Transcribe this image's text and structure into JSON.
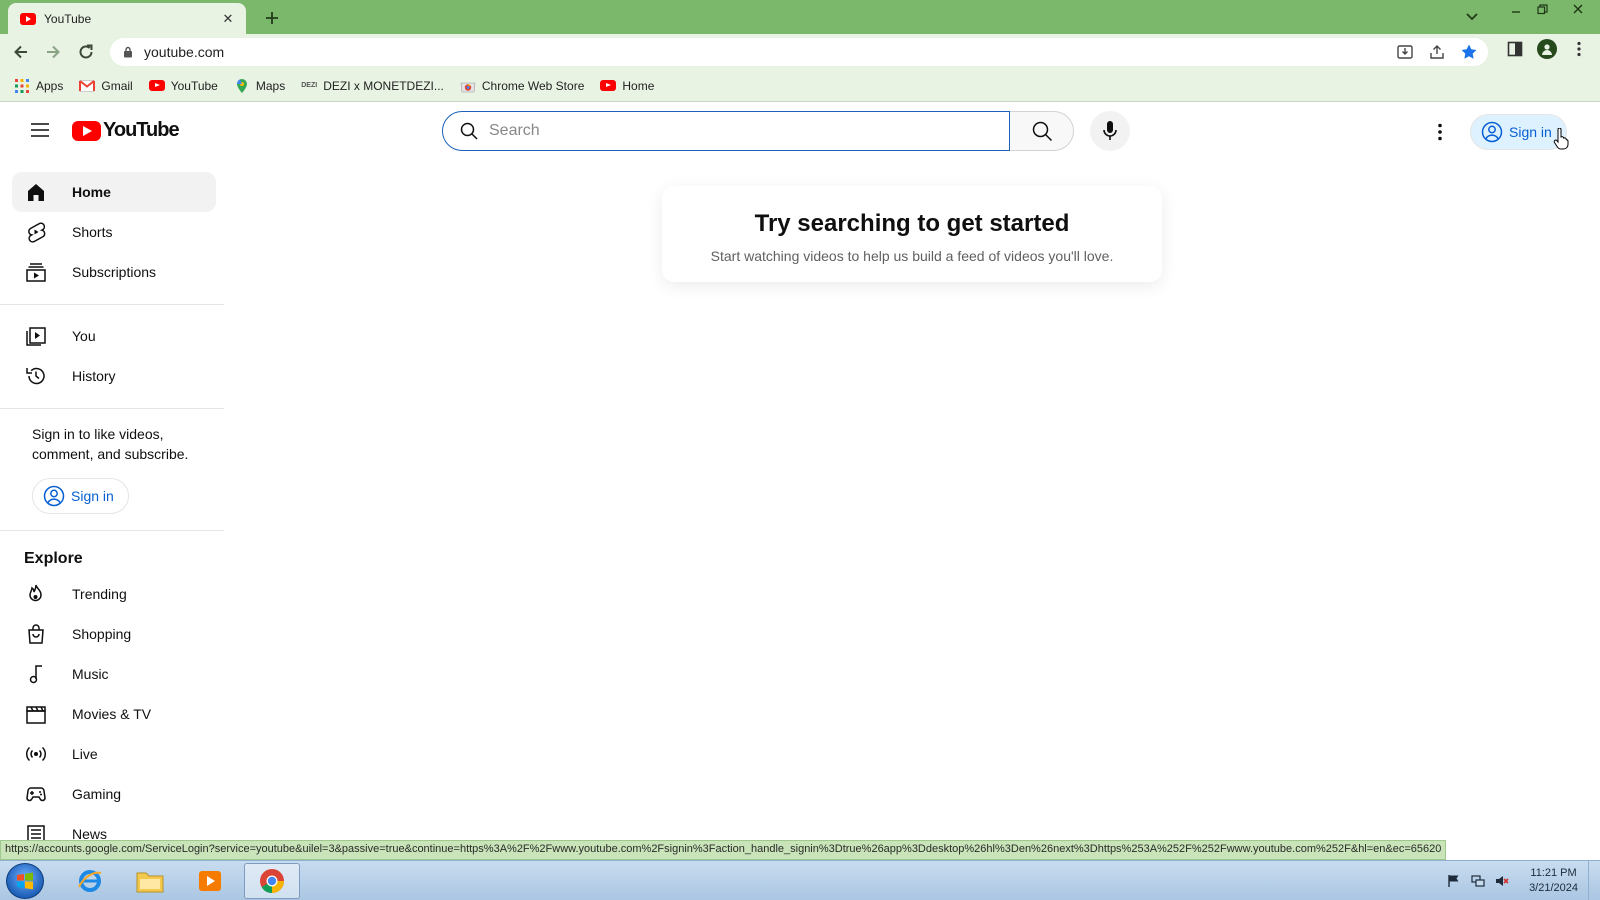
{
  "browser": {
    "tab_title": "YouTube",
    "url": "youtube.com",
    "bookmarks": [
      {
        "label": "Apps",
        "icon": "apps-grid-icon"
      },
      {
        "label": "Gmail",
        "icon": "gmail-icon"
      },
      {
        "label": "YouTube",
        "icon": "youtube-icon"
      },
      {
        "label": "Maps",
        "icon": "maps-icon"
      },
      {
        "label": "DEZI x MONETDEZI...",
        "icon": "dezi-icon"
      },
      {
        "label": "Chrome Web Store",
        "icon": "chrome-web-store-icon"
      },
      {
        "label": "Home",
        "icon": "youtube-icon"
      }
    ],
    "status_url": "https://accounts.google.com/ServiceLogin?service=youtube&uilel=3&passive=true&continue=https%3A%2F%2Fwww.youtube.com%2Fsignin%3Faction_handle_signin%3Dtrue%26app%3Ddesktop%26hl%3Den%26next%3Dhttps%253A%252F%252Fwww.youtube.com%252F&hl=en&ec=65620"
  },
  "youtube": {
    "logo_text": "YouTube",
    "search_placeholder": "Search",
    "signin_label": "Sign in",
    "sidebar": {
      "primary": [
        {
          "label": "Home",
          "icon": "home-icon",
          "active": true
        },
        {
          "label": "Shorts",
          "icon": "shorts-icon"
        },
        {
          "label": "Subscriptions",
          "icon": "subscriptions-icon"
        }
      ],
      "you": [
        {
          "label": "You",
          "icon": "you-library-icon"
        },
        {
          "label": "History",
          "icon": "history-icon"
        }
      ],
      "signin_prompt": "Sign in to like videos, comment, and subscribe.",
      "signin_label": "Sign in",
      "explore_title": "Explore",
      "explore": [
        {
          "label": "Trending",
          "icon": "trending-icon"
        },
        {
          "label": "Shopping",
          "icon": "shopping-icon"
        },
        {
          "label": "Music",
          "icon": "music-icon"
        },
        {
          "label": "Movies & TV",
          "icon": "movies-icon"
        },
        {
          "label": "Live",
          "icon": "live-icon"
        },
        {
          "label": "Gaming",
          "icon": "gaming-icon"
        },
        {
          "label": "News",
          "icon": "news-icon"
        }
      ]
    },
    "feed": {
      "title": "Try searching to get started",
      "subtitle": "Start watching videos to help us build a feed of videos you'll love."
    }
  },
  "taskbar": {
    "time": "11:21 PM",
    "date": "3/21/2024"
  },
  "colors": {
    "chrome_frame": "#7cb86b",
    "chrome_toolbar": "#e9f3e4",
    "youtube_red": "#ff0000",
    "link_blue": "#065fd4"
  }
}
